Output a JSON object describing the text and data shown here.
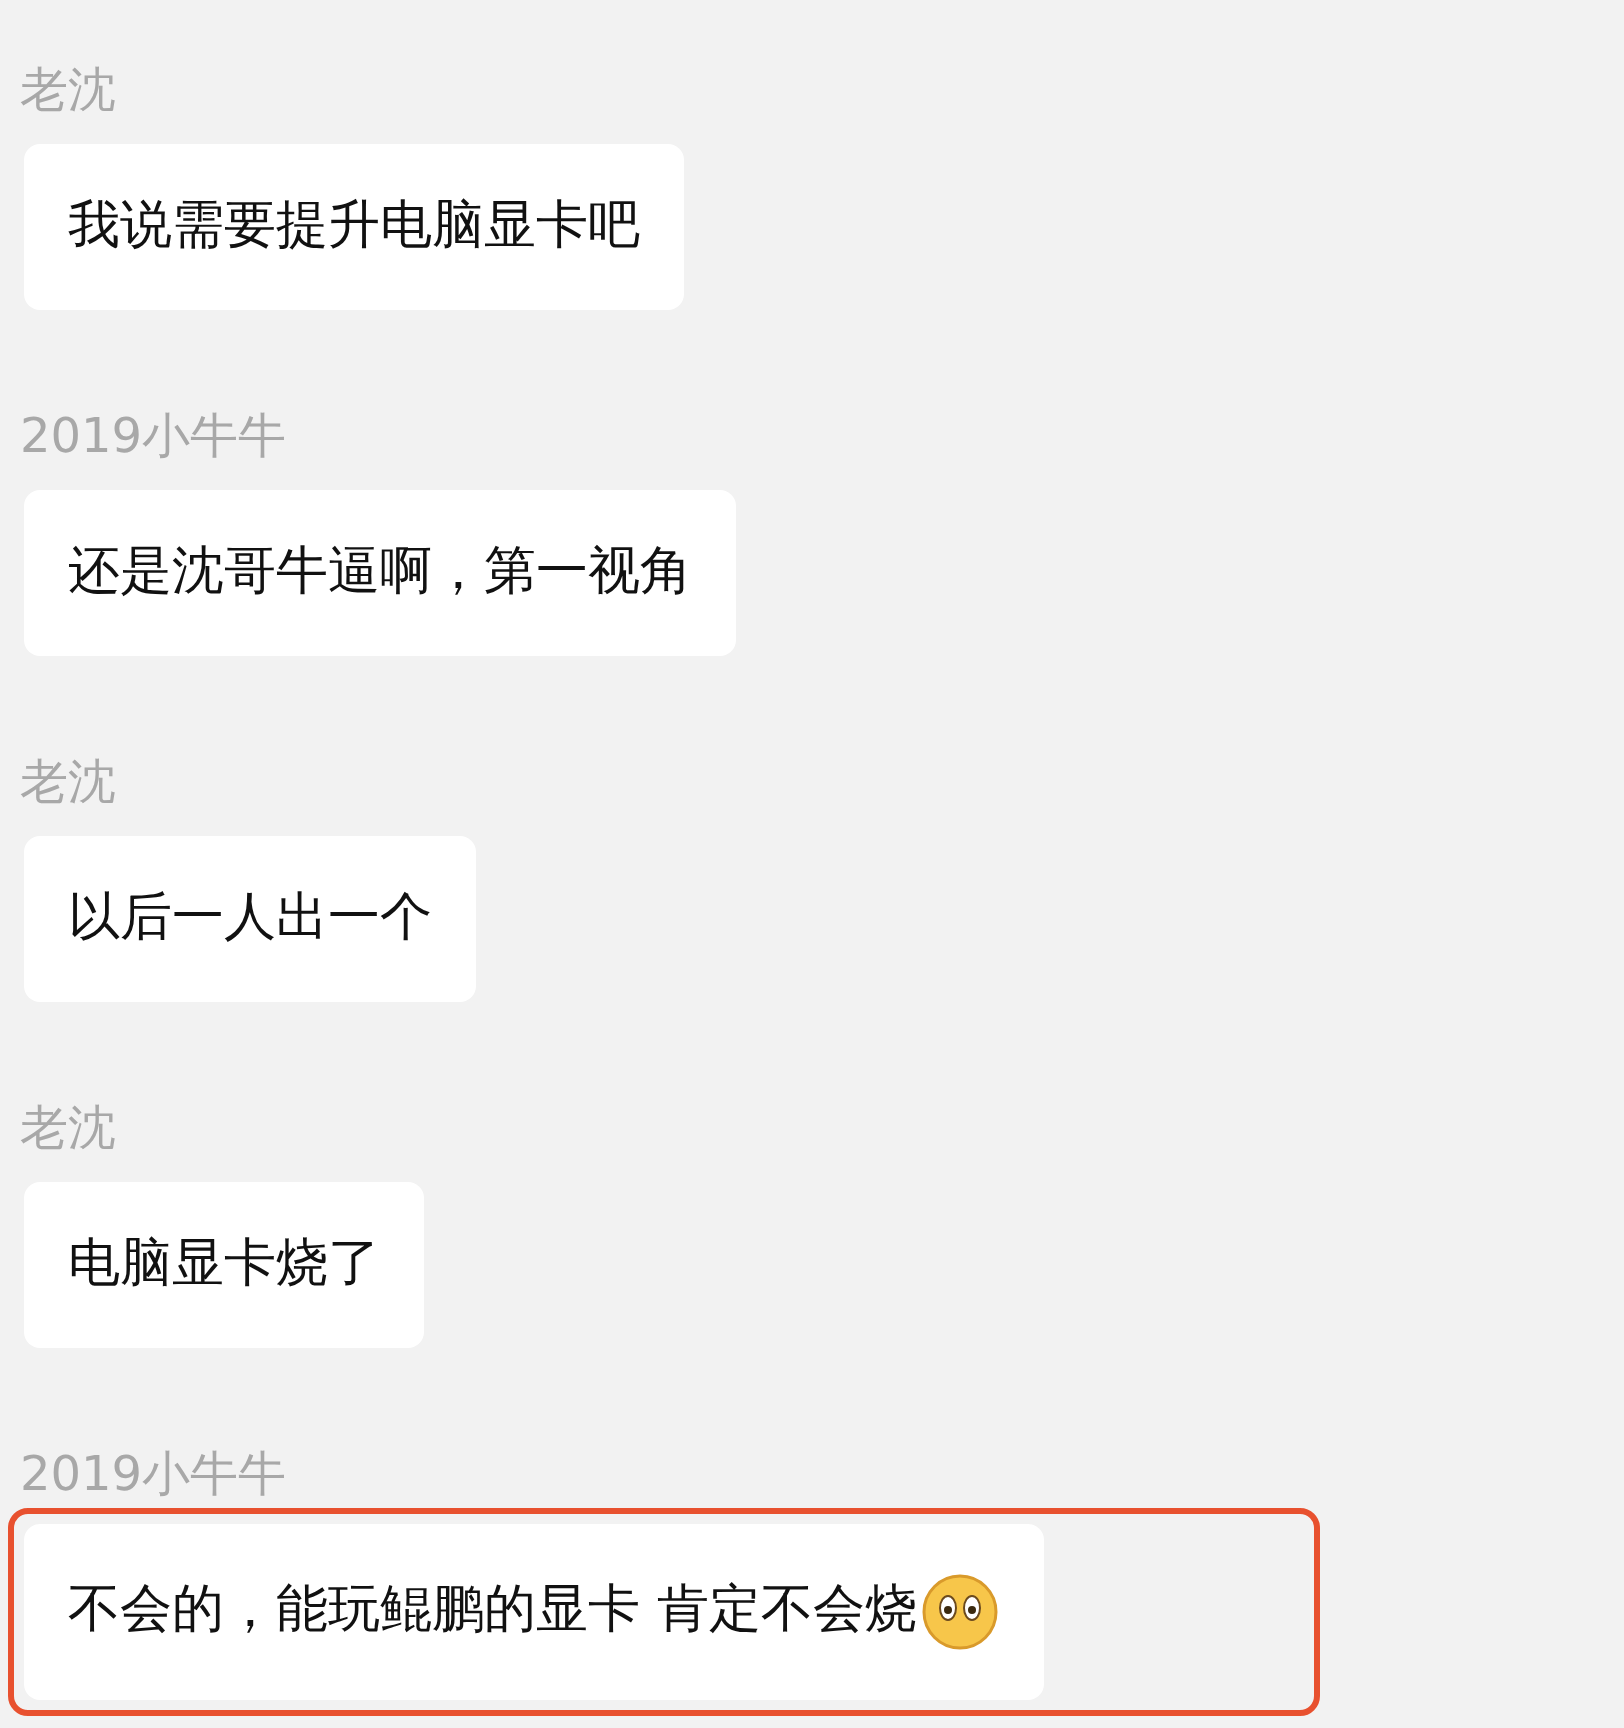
{
  "messages": [
    {
      "sender": "老沈",
      "text": "我说需要提升电脑显卡吧",
      "highlighted": false,
      "emoji": false
    },
    {
      "sender": "2019小牛牛",
      "text": "还是沈哥牛逼啊，第一视角",
      "highlighted": false,
      "emoji": false
    },
    {
      "sender": "老沈",
      "text": "以后一人出一个",
      "highlighted": false,
      "emoji": false
    },
    {
      "sender": "老沈",
      "text": "电脑显卡烧了",
      "highlighted": false,
      "emoji": false
    },
    {
      "sender": "2019小牛牛",
      "text": "不会的，能玩鲲鹏的显卡 肯定不会烧",
      "highlighted": true,
      "emoji": true
    }
  ]
}
